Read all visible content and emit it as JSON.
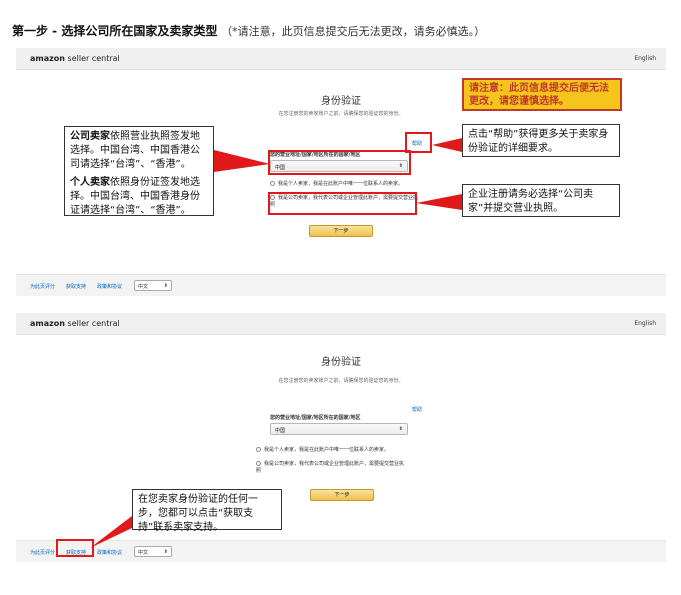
{
  "step_title": {
    "main": "第一步 - 选择公司所在国家及卖家类型",
    "note": "（*请注意，此页信息提交后无法更改，请务必慎选。）"
  },
  "header": {
    "logo_brand": "amazon",
    "logo_product": "seller central",
    "lang": "English"
  },
  "verify": {
    "title": "身份验证",
    "subtitle": "在您注册您的卖家账户之前，请确保您的验证您的身份。",
    "help_link": "帮助",
    "field_label": "您的营业地址/国家/地区所在的国家/地区",
    "country_value": "中国",
    "option_individual": "我是个人卖家，我是在此账户中唯一一位联系人的卖家。",
    "option_business": "我是公司卖家，我代表公司或企业管理此账户，需要提交营业执照",
    "next_button": "下一步"
  },
  "footer": {
    "links": [
      "为此页评分",
      "获取支持",
      "政策和协议"
    ],
    "lang_select": "中文"
  },
  "callouts": {
    "left_line1_bold": "公司卖家",
    "left_line1_rest": "依照营业执照签发地选择。中国台湾、中国香港公司请选择“台湾”、“香港”。",
    "left_line2_bold": "个人卖家",
    "left_line2_rest": "依照身份证签发地选择。中国台湾、中国香港身份证请选择“台湾”、“香港”。",
    "warning": "请注意：此页信息提交后便无法更改，请您谨慎选择。",
    "help_note": "点击“帮助”获得更多关于卖家身份验证的详细要求。",
    "business_note": "企业注册请务必选择“公司卖家”并提交营业执照。",
    "support_note": "在您卖家身份验证的任何一步，您都可以点击“获取支持”联系卖家支持。"
  },
  "colors": {
    "annotation_red": "#e01a1a",
    "warning_bg": "#f5c51b",
    "link_blue": "#0066c0",
    "button_gold": "#f0c14b"
  }
}
